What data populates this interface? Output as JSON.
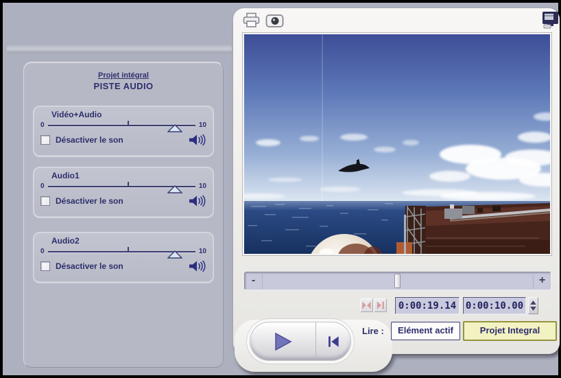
{
  "audio_panel": {
    "header_link": "Projet intégral",
    "header_title": "PISTE AUDIO",
    "tracks": [
      {
        "label": "Vidéo+Audio",
        "min": "0",
        "max": "10",
        "mute_label": "Désactiver le son",
        "volume_icon": "speaker-icon"
      },
      {
        "label": "Audio1",
        "min": "0",
        "max": "10",
        "mute_label": "Désactiver le son",
        "volume_icon": "speaker-icon"
      },
      {
        "label": "Audio2",
        "min": "0",
        "max": "10",
        "mute_label": "Désactiver le son",
        "volume_icon": "speaker-icon"
      }
    ]
  },
  "player": {
    "toolbar_icons": [
      "printer-icon",
      "snapshot-camera-icon",
      "monitor-icon"
    ],
    "video_description": "Fighter jet on approach over the ocean toward an aircraft carrier deck",
    "scrubber": {
      "minus_label": "-",
      "plus_label": "+",
      "thumb_position_pct": 50
    },
    "trim_icons": [
      "mark-in-out-icon",
      "mark-to-end-icon"
    ],
    "timecode_position": "0:00:19.14",
    "timecode_duration": "0:00:10.00",
    "lire_label": "Lire :",
    "mode_buttons": [
      {
        "label": "Elément actif",
        "selected": false
      },
      {
        "label": "Projet Integral",
        "selected": true
      }
    ]
  },
  "colors": {
    "background": "#adb0be",
    "panel_bg": "#b6b9c5",
    "text_navy": "#2d2d6b",
    "play_triangle": "#7174ba",
    "timecode_bg": "#c9cadd",
    "selected_mode_bg": "#f2f2c2",
    "selected_mode_border": "#94943c",
    "disabled_icon_pink": "#d79d9d"
  }
}
